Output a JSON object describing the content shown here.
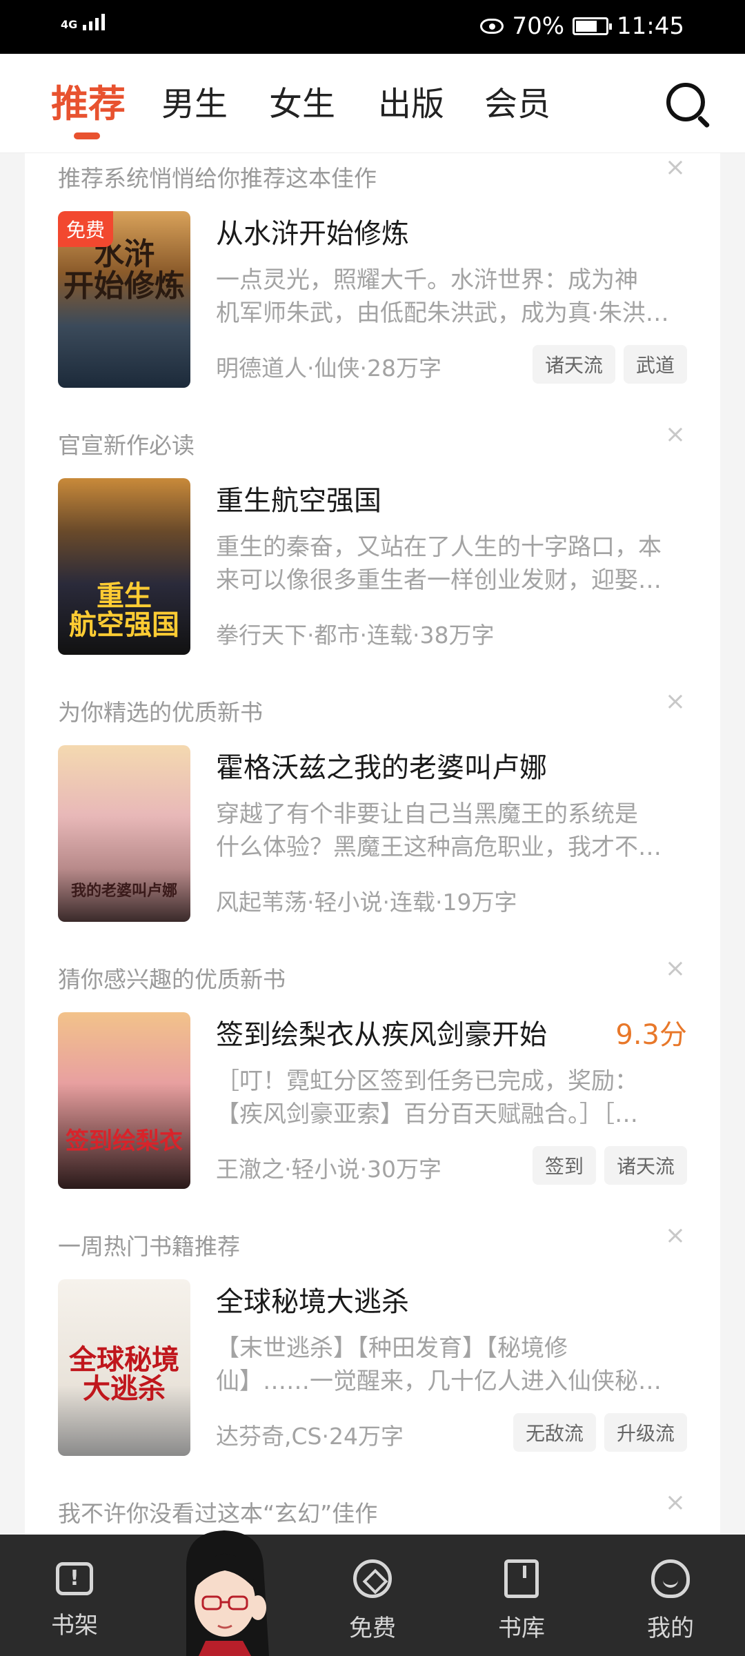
{
  "status_bar": {
    "network": "4G",
    "battery": "70%",
    "time": "11:45"
  },
  "top_nav": {
    "tabs": [
      {
        "label": "推荐",
        "active": true
      },
      {
        "label": "男生"
      },
      {
        "label": "女生"
      },
      {
        "label": "出版"
      },
      {
        "label": "会员"
      }
    ]
  },
  "feed": {
    "items": [
      {
        "section": "推荐系统悄悄给你推荐这本佳作",
        "close": "×",
        "cover_text": "水浒\n开始修炼",
        "badge": "免费",
        "title": "从水浒开始修炼",
        "score": "",
        "desc_line1": "一点灵光，照耀大千。水浒世界：成为神",
        "desc_line2": "机军师朱武，由低配朱洪武，成为真·朱洪…",
        "meta": "明德道人·仙侠·28万字",
        "tags": [
          "诸天流",
          "武道"
        ]
      },
      {
        "section": "官宣新作必读",
        "close": "×",
        "cover_text": "重生\n航空强国",
        "badge": "",
        "title": "重生航空强国",
        "score": "",
        "desc_line1": "重生的秦奋，又站在了人生的十字路口，本",
        "desc_line2": "来可以像很多重生者一样创业发财，迎娶…",
        "meta": "拳行天下·都市·连载·38万字",
        "tags": []
      },
      {
        "section": "为你精选的优质新书",
        "close": "×",
        "cover_text": "我的老婆叫卢娜",
        "badge": "",
        "title": "霍格沃兹之我的老婆叫卢娜",
        "score": "",
        "desc_line1": "穿越了有个非要让自己当黑魔王的系统是",
        "desc_line2": "什么体验？黑魔王这种高危职业，我才不…",
        "meta": "风起苇荡·轻小说·连载·19万字",
        "tags": []
      },
      {
        "section": "猜你感兴趣的优质新书",
        "close": "×",
        "cover_text": "签到绘梨衣",
        "badge": "",
        "title": "签到绘梨衣从疾风剑豪开始",
        "score": "9.3分",
        "desc_line1": "［叮！霓虹分区签到任务已完成，奖励：",
        "desc_line2": "【疾风剑豪亚索】百分百天赋融合。］［…",
        "meta": "王澈之·轻小说·30万字",
        "tags": [
          "签到",
          "诸天流"
        ]
      },
      {
        "section": "一周热门书籍推荐",
        "close": "×",
        "cover_text": "全球秘境\n大逃杀",
        "badge": "",
        "title": "全球秘境大逃杀",
        "score": "",
        "desc_line1": "【末世逃杀】【种田发育】【秘境修",
        "desc_line2": "仙】……一觉醒来，几十亿人进入仙侠秘…",
        "meta": "达芬奇,CS·24万字",
        "tags": [
          "无敌流",
          "升级流"
        ]
      },
      {
        "section": "我不许你没看过这本“玄幻”佳作",
        "close": "×"
      }
    ]
  },
  "bottom_nav": {
    "items": [
      {
        "label": "书架",
        "icon": "bookshelf-icon"
      },
      {
        "label": "免费",
        "icon": "free-icon"
      },
      {
        "label": "书库",
        "icon": "library-icon"
      },
      {
        "label": "我的",
        "icon": "profile-icon"
      }
    ]
  },
  "colors": {
    "accent": "#e8522f",
    "score": "#e8782a",
    "badge": "#f2482f"
  }
}
